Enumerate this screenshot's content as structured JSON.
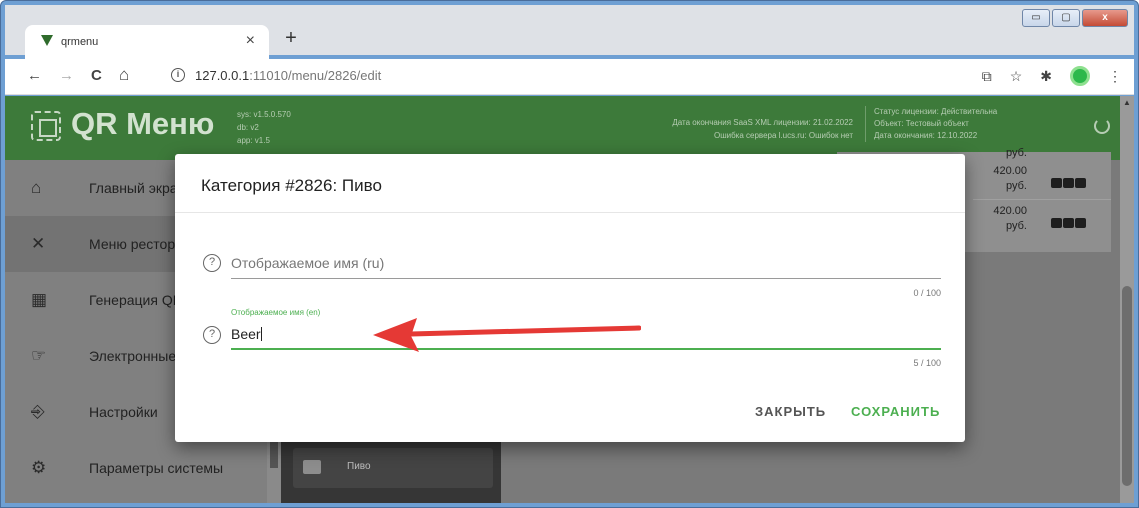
{
  "browser": {
    "tab_title": "qrmenu",
    "tab_close": "×",
    "new_tab": "+",
    "url_host": "127.0.0.1",
    "url_rest": ":11010/menu/2826/edit",
    "nav_back": "←",
    "nav_forward": "→",
    "nav_reload": "C",
    "nav_home": "⌂",
    "ext_icons": [
      "⧉",
      "☆",
      "✱",
      "⋮"
    ],
    "window_buttons": [
      "▭",
      "▢",
      "x"
    ]
  },
  "app": {
    "title": "QR Меню",
    "versions": [
      "sys: v1.5.0.570",
      "db: v2",
      "app: v1.5"
    ],
    "license": [
      "Дата окончания SaaS XML лицензии: 21.02.2022",
      "Ошибка сервера l.ucs.ru: Ошибок нет"
    ],
    "status": [
      "Статус лицензии: Действительна",
      "Объект: Тестовый объект",
      "Дата окончания: 12.10.2022"
    ]
  },
  "sidebar": {
    "items": [
      {
        "icon": "home-icon",
        "glyph": "⌂",
        "label": "Главный экран"
      },
      {
        "icon": "utensils-icon",
        "glyph": "✕",
        "label": "Меню ресторана"
      },
      {
        "icon": "qr-code-icon",
        "glyph": "▦",
        "label": "Генерация QR"
      },
      {
        "icon": "touch-icon",
        "glyph": "☞",
        "label": "Электронные"
      },
      {
        "icon": "login-icon",
        "glyph": "⎆",
        "label": "Настройки"
      },
      {
        "icon": "gear-icon",
        "glyph": "⚙",
        "label": "Параметры системы"
      }
    ]
  },
  "table": {
    "rows": [
      {
        "price": "420.00",
        "unit": "руб."
      },
      {
        "price": "420.00",
        "unit": "руб."
      }
    ],
    "partial_unit": "руб."
  },
  "folder": {
    "label": "Пиво"
  },
  "dialog": {
    "title": "Категория #2826: Пиво",
    "help": "?",
    "field_ru": {
      "placeholder": "Отображаемое имя (ru)",
      "counter": "0 / 100"
    },
    "field_en": {
      "label": "Отображаемое имя (en)",
      "value": "Beer",
      "counter": "5 / 100"
    },
    "close_label": "ЗАКРЫТЬ",
    "save_label": "СОХРАНИТЬ"
  },
  "colors": {
    "appbar": "#3d7a3a",
    "accent": "#4caf50",
    "arrow": "#e53935"
  }
}
